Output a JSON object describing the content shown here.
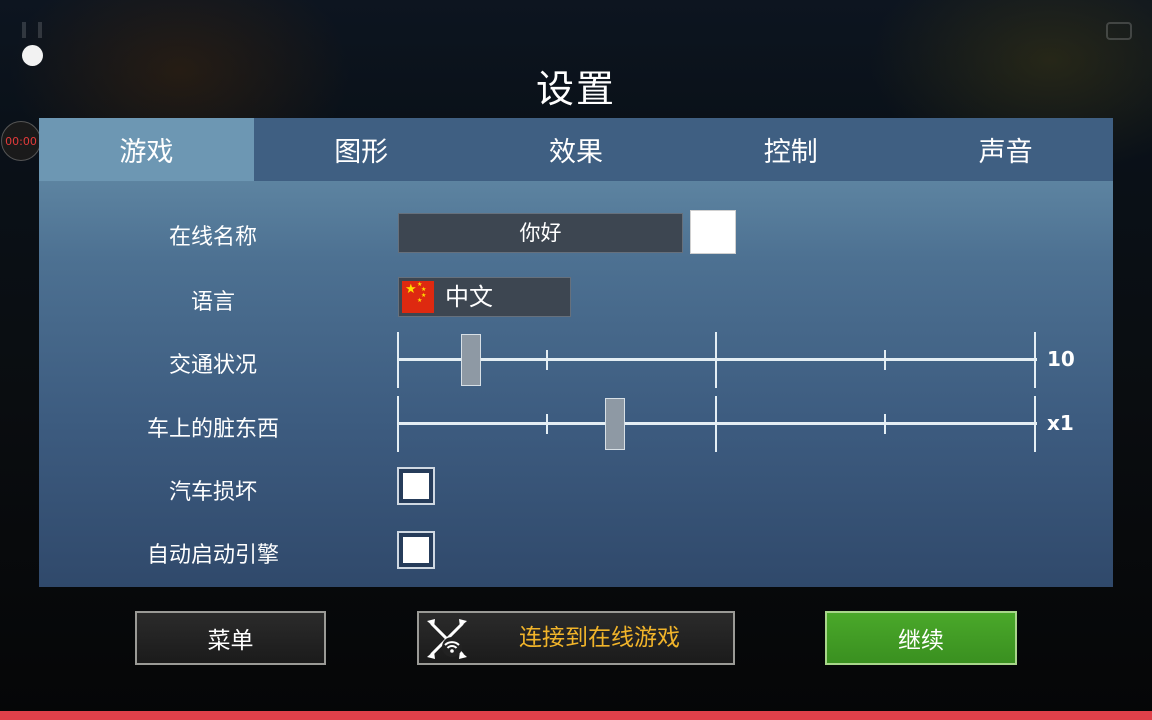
{
  "title": "设置",
  "overlay": {
    "timer": "00:00"
  },
  "tabs": [
    {
      "label": "游戏",
      "active": true
    },
    {
      "label": "图形",
      "active": false
    },
    {
      "label": "效果",
      "active": false
    },
    {
      "label": "控制",
      "active": false
    },
    {
      "label": "声音",
      "active": false
    }
  ],
  "settings": {
    "online_name": {
      "label": "在线名称",
      "value": "你好",
      "color": "#ffffff"
    },
    "language": {
      "label": "语言",
      "value": "中文",
      "flag_icon": "china-flag-icon"
    },
    "traffic": {
      "label": "交通状况",
      "value_text": "10",
      "fraction": 0.115
    },
    "dirt": {
      "label": "车上的脏东西",
      "value_text": "x1",
      "fraction": 0.34
    },
    "car_damage": {
      "label": "汽车损坏",
      "checked": false
    },
    "auto_start_engine": {
      "label": "自动启动引擎",
      "checked": false
    }
  },
  "buttons": {
    "menu": "菜单",
    "online": "连接到在线游戏",
    "online_icon": "crossed-wrenches-wifi-icon",
    "continue": "继续"
  },
  "colors": {
    "tab_active": "#6d97b3",
    "continue_green": "#43a024",
    "online_text": "#f1b42a",
    "bottom_bar": "#e0404a"
  }
}
